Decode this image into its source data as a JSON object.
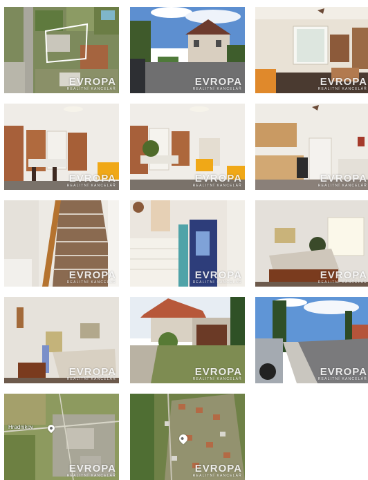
{
  "watermark": {
    "brand": "EVROPA",
    "tagline": "REALITNÍ KANCELÁŘ"
  },
  "gallery": {
    "photos": [
      {
        "name": "aerial-plot"
      },
      {
        "name": "street-house-exterior"
      },
      {
        "name": "living-room-window"
      },
      {
        "name": "dining-room"
      },
      {
        "name": "dining-room-alt"
      },
      {
        "name": "kitchen"
      },
      {
        "name": "staircase"
      },
      {
        "name": "bathroom-hallway"
      },
      {
        "name": "bedroom"
      },
      {
        "name": "bedroom-alt"
      },
      {
        "name": "garden-garage"
      },
      {
        "name": "street-view"
      },
      {
        "name": "map-overview"
      },
      {
        "name": "map-detail"
      }
    ]
  },
  "map_overview": {
    "place_label": "Hradnikov"
  }
}
